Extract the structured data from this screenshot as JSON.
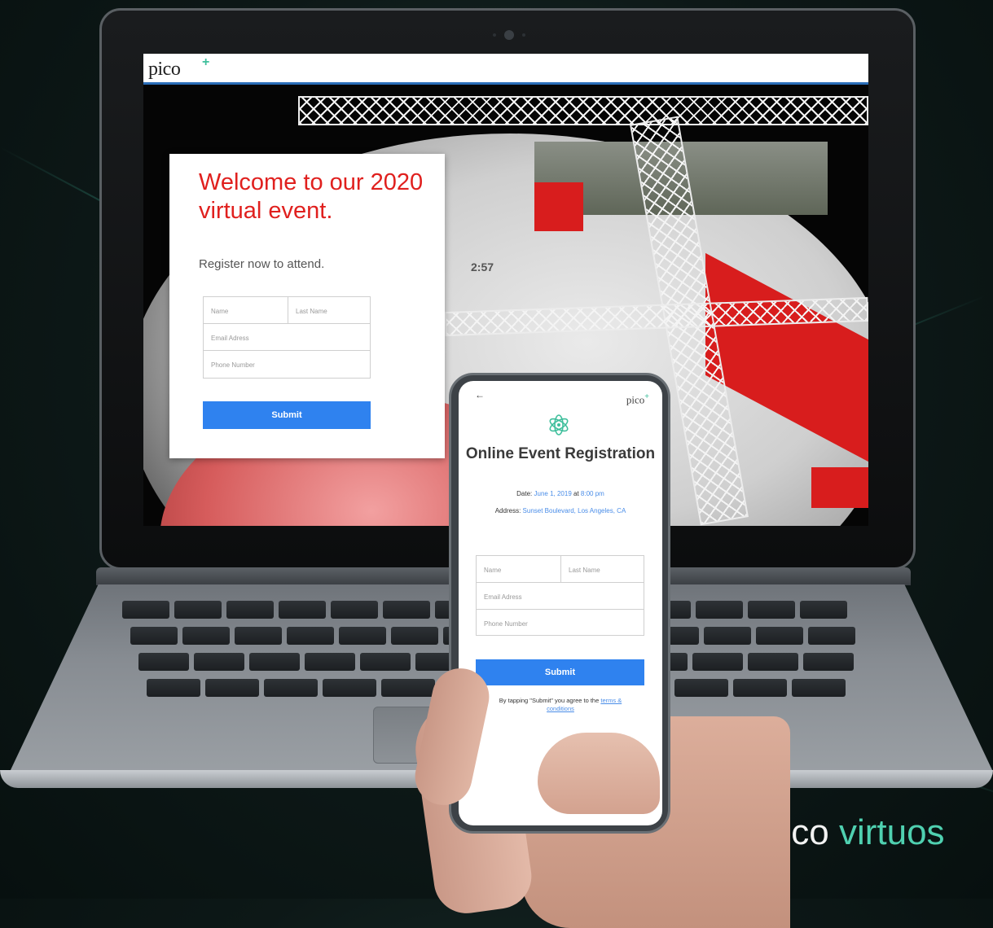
{
  "laptop_site": {
    "logo_text": "pico",
    "logo_plus": "+",
    "card": {
      "title": "Welcome to our 2020 virtual event.",
      "subtitle": "Register now to attend.",
      "fields": {
        "first_name_placeholder": "Name",
        "last_name_placeholder": "Last Name",
        "email_placeholder": "Email Adress",
        "phone_placeholder": "Phone Number"
      },
      "submit_label": "Submit"
    },
    "scene_sign": "2:57"
  },
  "phone_site": {
    "back_icon": "back-arrow-icon",
    "logo_text": "pico",
    "logo_plus": "+",
    "icon": "atom-icon",
    "title": "Online Event Registration",
    "date_label": "Date:",
    "date_value": "June 1, 2019",
    "date_at": "at",
    "time_value": "8:00 pm",
    "address_label": "Address:",
    "address_value": "Sunset Boulevard, Los Angeles, CA",
    "fields": {
      "first_name_placeholder": "Name",
      "last_name_placeholder": "Last Name",
      "email_placeholder": "Email Adress",
      "phone_placeholder": "Phone Number"
    },
    "submit_label": "Submit",
    "terms_prefix": "By tapping \"Submit\" you agree to the",
    "terms_link": "terms & conditions"
  },
  "brand": {
    "word1": "pico",
    "word2": "virtuos"
  },
  "colors": {
    "accent_red": "#e0201e",
    "button_blue": "#2f82ef",
    "brand_teal": "#4fd0b0"
  }
}
